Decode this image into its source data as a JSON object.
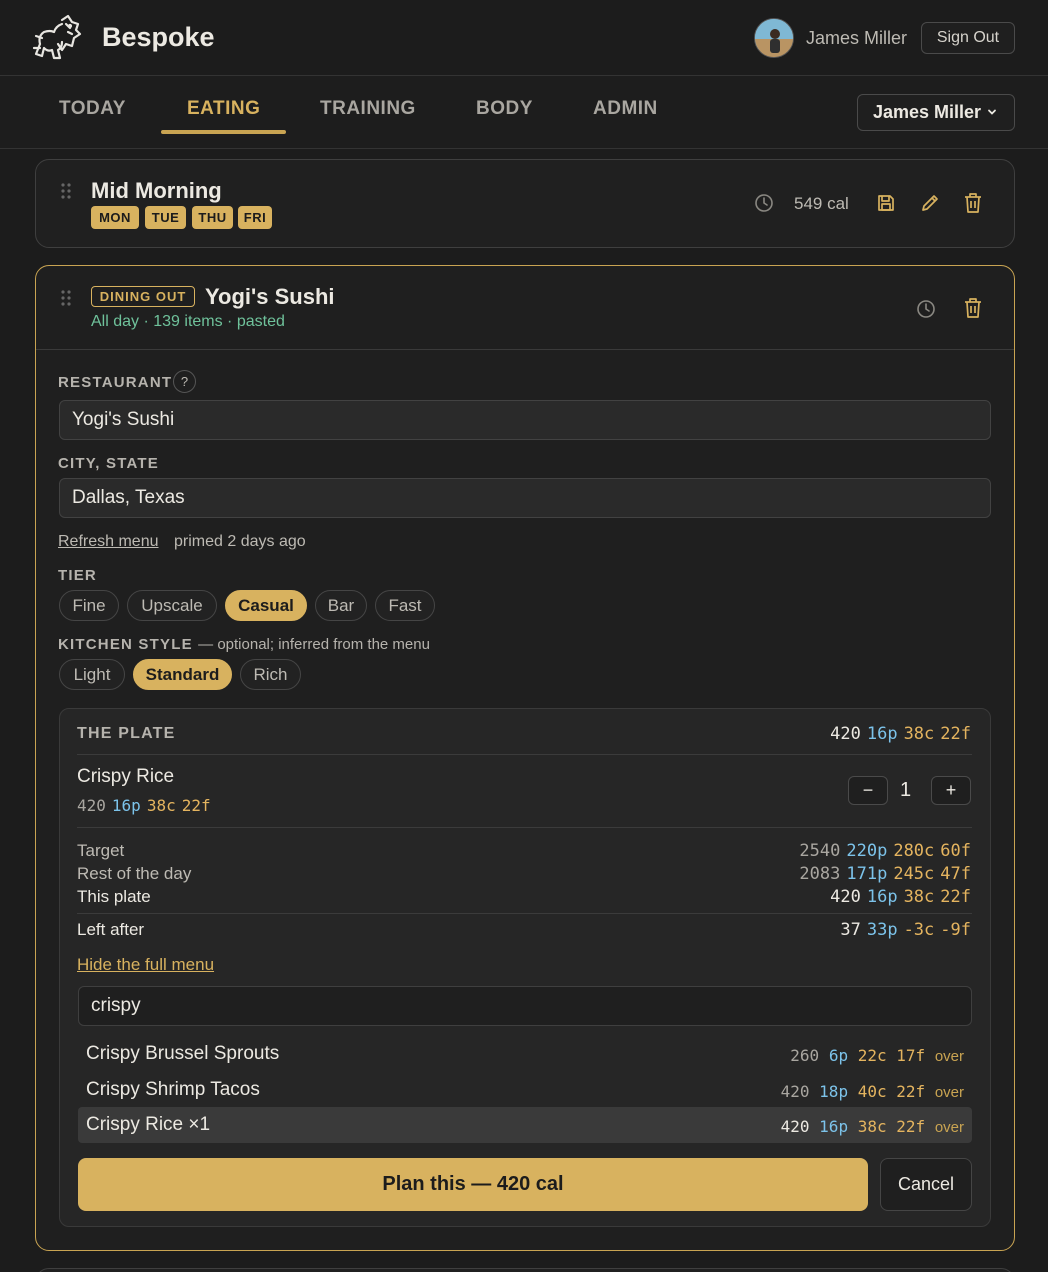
{
  "header": {
    "brand": "Bespoke",
    "user_name": "James Miller",
    "sign_out_label": "Sign Out"
  },
  "nav": {
    "tabs": [
      {
        "label": "TODAY",
        "active": false
      },
      {
        "label": "EATING",
        "active": true
      },
      {
        "label": "TRAINING",
        "active": false
      },
      {
        "label": "BODY",
        "active": false
      },
      {
        "label": "ADMIN",
        "active": false
      }
    ],
    "user_select": "James Miller"
  },
  "meal1": {
    "title": "Mid Morning",
    "days": [
      "MON",
      "TUE",
      "THU",
      "FRI"
    ],
    "calories": "549 cal"
  },
  "meal2": {
    "badge": "DINING OUT",
    "title": "Yogi's Sushi",
    "subline": "All day · 139 items · pasted",
    "restaurant_label": "RESTAURANT",
    "help_glyph": "?",
    "restaurant_value": "Yogi's Sushi",
    "city_label": "CITY, STATE",
    "city_value": "Dallas, Texas",
    "refresh_label": "Refresh menu",
    "primed_text": "primed 2 days ago",
    "tier_label": "TIER",
    "tiers": [
      {
        "label": "Fine",
        "selected": false
      },
      {
        "label": "Upscale",
        "selected": false
      },
      {
        "label": "Casual",
        "selected": true
      },
      {
        "label": "Bar",
        "selected": false
      },
      {
        "label": "Fast",
        "selected": false
      }
    ],
    "kitchen_label": "KITCHEN STYLE",
    "kitchen_note": "— optional; inferred from the menu",
    "kitchen_styles": [
      {
        "label": "Light",
        "selected": false
      },
      {
        "label": "Standard",
        "selected": true
      },
      {
        "label": "Rich",
        "selected": false
      }
    ]
  },
  "plate": {
    "title": "THE PLATE",
    "totals": {
      "cal": "420",
      "p": "16p",
      "c": "38c",
      "f": "22f"
    },
    "item": {
      "name": "Crispy Rice",
      "macros": {
        "cal": "420",
        "p": "16p",
        "c": "38c",
        "f": "22f"
      },
      "qty": "1",
      "minus": "−",
      "plus": "+"
    },
    "summary": [
      {
        "label": "Target",
        "cal": "2540",
        "p": "220p",
        "c": "280c",
        "f": "60f"
      },
      {
        "label": "Rest of the day",
        "cal": "2083",
        "p": "171p",
        "c": "245c",
        "f": "47f"
      },
      {
        "label": "This plate",
        "cal": "420",
        "p": "16p",
        "c": "38c",
        "f": "22f"
      }
    ],
    "left_after": {
      "label": "Left after",
      "cal": "37",
      "p": "33p",
      "c": "-3c",
      "f": "-9f"
    },
    "hide_menu_label": "Hide the full menu",
    "search_value": "crispy",
    "results": [
      {
        "name": "Crispy Brussel Sprouts",
        "cal": "260",
        "p": "6p",
        "c": "22c",
        "f": "17f",
        "flag": "over",
        "highlighted": false
      },
      {
        "name": "Crispy Shrimp Tacos",
        "cal": "420",
        "p": "18p",
        "c": "40c",
        "f": "22f",
        "flag": "over",
        "highlighted": false
      },
      {
        "name": "Crispy Rice ×1",
        "cal": "420",
        "p": "16p",
        "c": "38c",
        "f": "22f",
        "flag": "over",
        "highlighted": true
      }
    ],
    "plan_label": "Plan this — 420 cal",
    "cancel_label": "Cancel"
  },
  "colors": {
    "accent": "#d8b25f",
    "protein": "#7cc3ea",
    "carbs_fat": "#e4b45f",
    "meta_green": "#6fc29b",
    "background": "#1c1c1c"
  },
  "icons": [
    "lion-logo-icon",
    "clock-icon",
    "save-icon",
    "edit-pencil-icon",
    "trash-icon",
    "drag-handle-icon",
    "chevron-down-icon"
  ]
}
